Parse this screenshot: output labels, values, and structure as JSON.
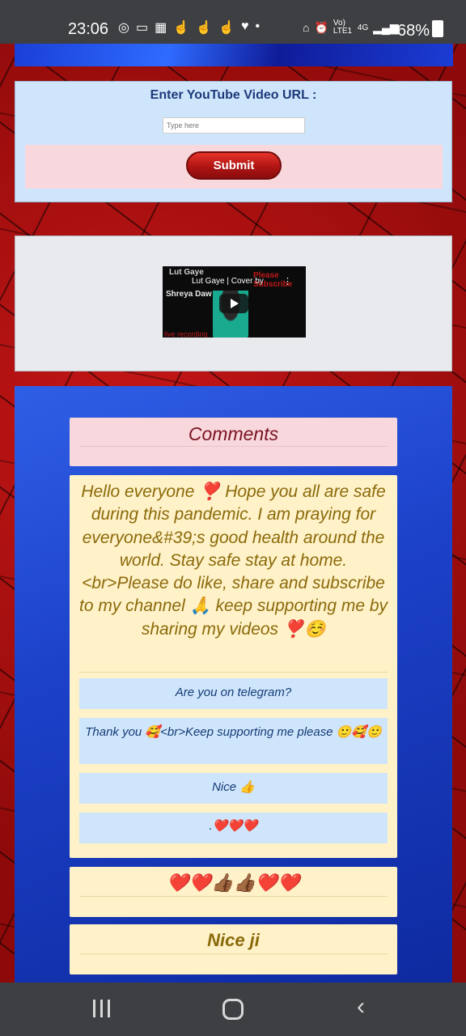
{
  "status_bar": {
    "time": "23:06",
    "left_icons": [
      "instagram-icon",
      "laptop-icon",
      "calculator-icon",
      "hand-icon",
      "hand-icon",
      "hand-icon",
      "heart-icon",
      "dot-icon"
    ],
    "network_text": "Vo) LTE1",
    "network_type": "4G",
    "battery": "68%"
  },
  "form": {
    "label": "Enter YouTube Video URL :",
    "input_value": "",
    "input_placeholder": "Type here",
    "submit_label": "Submit"
  },
  "video": {
    "title_overlay": "Lut Gaye",
    "title_line": "Lut Gaye | Cover by",
    "artist": "Shreya Daw",
    "overlay_right": "Please Subscribe",
    "bottom_text": "live recording"
  },
  "comments": {
    "header": "Comments",
    "items": [
      {
        "text": "Hello everyone ❣️ Hope you all are safe during this pandemic. I am praying for everyone&#39;s good health around the world. Stay safe stay at home.<br>Please do like, share and subscribe to my channel 🙏 keep supporting me by sharing my videos ❣️☺️",
        "replies": [
          "Are you on telegram?",
          "Thank you 🥰<br>Keep supporting me please 🙂🥰🙂",
          "Nice 👍",
          ".❤️❤️❤️"
        ]
      },
      {
        "text": "❤️❤️👍🏾👍🏾❤️❤️",
        "replies": []
      },
      {
        "text": "Nice ji",
        "replies": []
      }
    ]
  },
  "colors": {
    "panel_blue": "#cfe5fb",
    "panel_pink": "#f8d7dd",
    "comment_cream": "#fff1c8",
    "submit_red": "#c41b1b",
    "section_blue": "#1c41c9"
  }
}
